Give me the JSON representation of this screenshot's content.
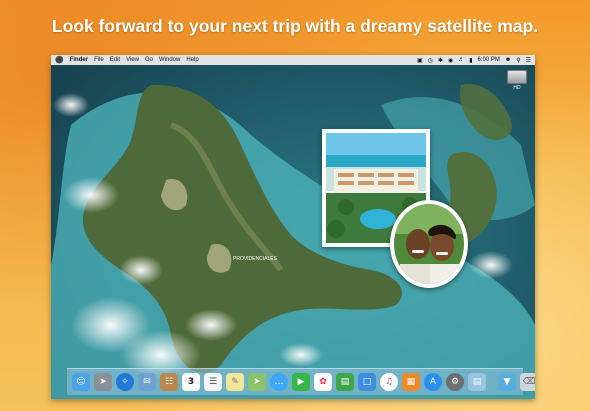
{
  "headline": "Look forward to your next trip with a dreamy satellite map.",
  "menubar": {
    "items": [
      "Finder",
      "File",
      "Edit",
      "View",
      "Go",
      "Window",
      "Help"
    ],
    "clock": "6:00 PM"
  },
  "desktop": {
    "drive_label": "HD",
    "map_label": "PROVIDENCIALES"
  },
  "dock": {
    "icons": [
      "finder-icon",
      "launchpad-icon",
      "safari-icon",
      "mail-icon",
      "contacts-icon",
      "calendar-icon",
      "reminders-icon",
      "notes-icon",
      "maps-icon",
      "messages-icon",
      "facetime-icon",
      "photos-icon",
      "numbers-icon",
      "keynote-icon",
      "itunes-icon",
      "ibooks-icon",
      "app-store-icon",
      "system-preferences-icon",
      "preview-icon",
      "downloads-folder-icon",
      "trash-icon"
    ],
    "calendar_day": "3"
  },
  "colors": {
    "background_top": "#f39a2c",
    "background_bottom": "#f6c15a",
    "headline": "#ffffff",
    "sea": "#1e5b6b",
    "shallow_water": "#5fc7c9",
    "land": "#4e6a3a"
  }
}
